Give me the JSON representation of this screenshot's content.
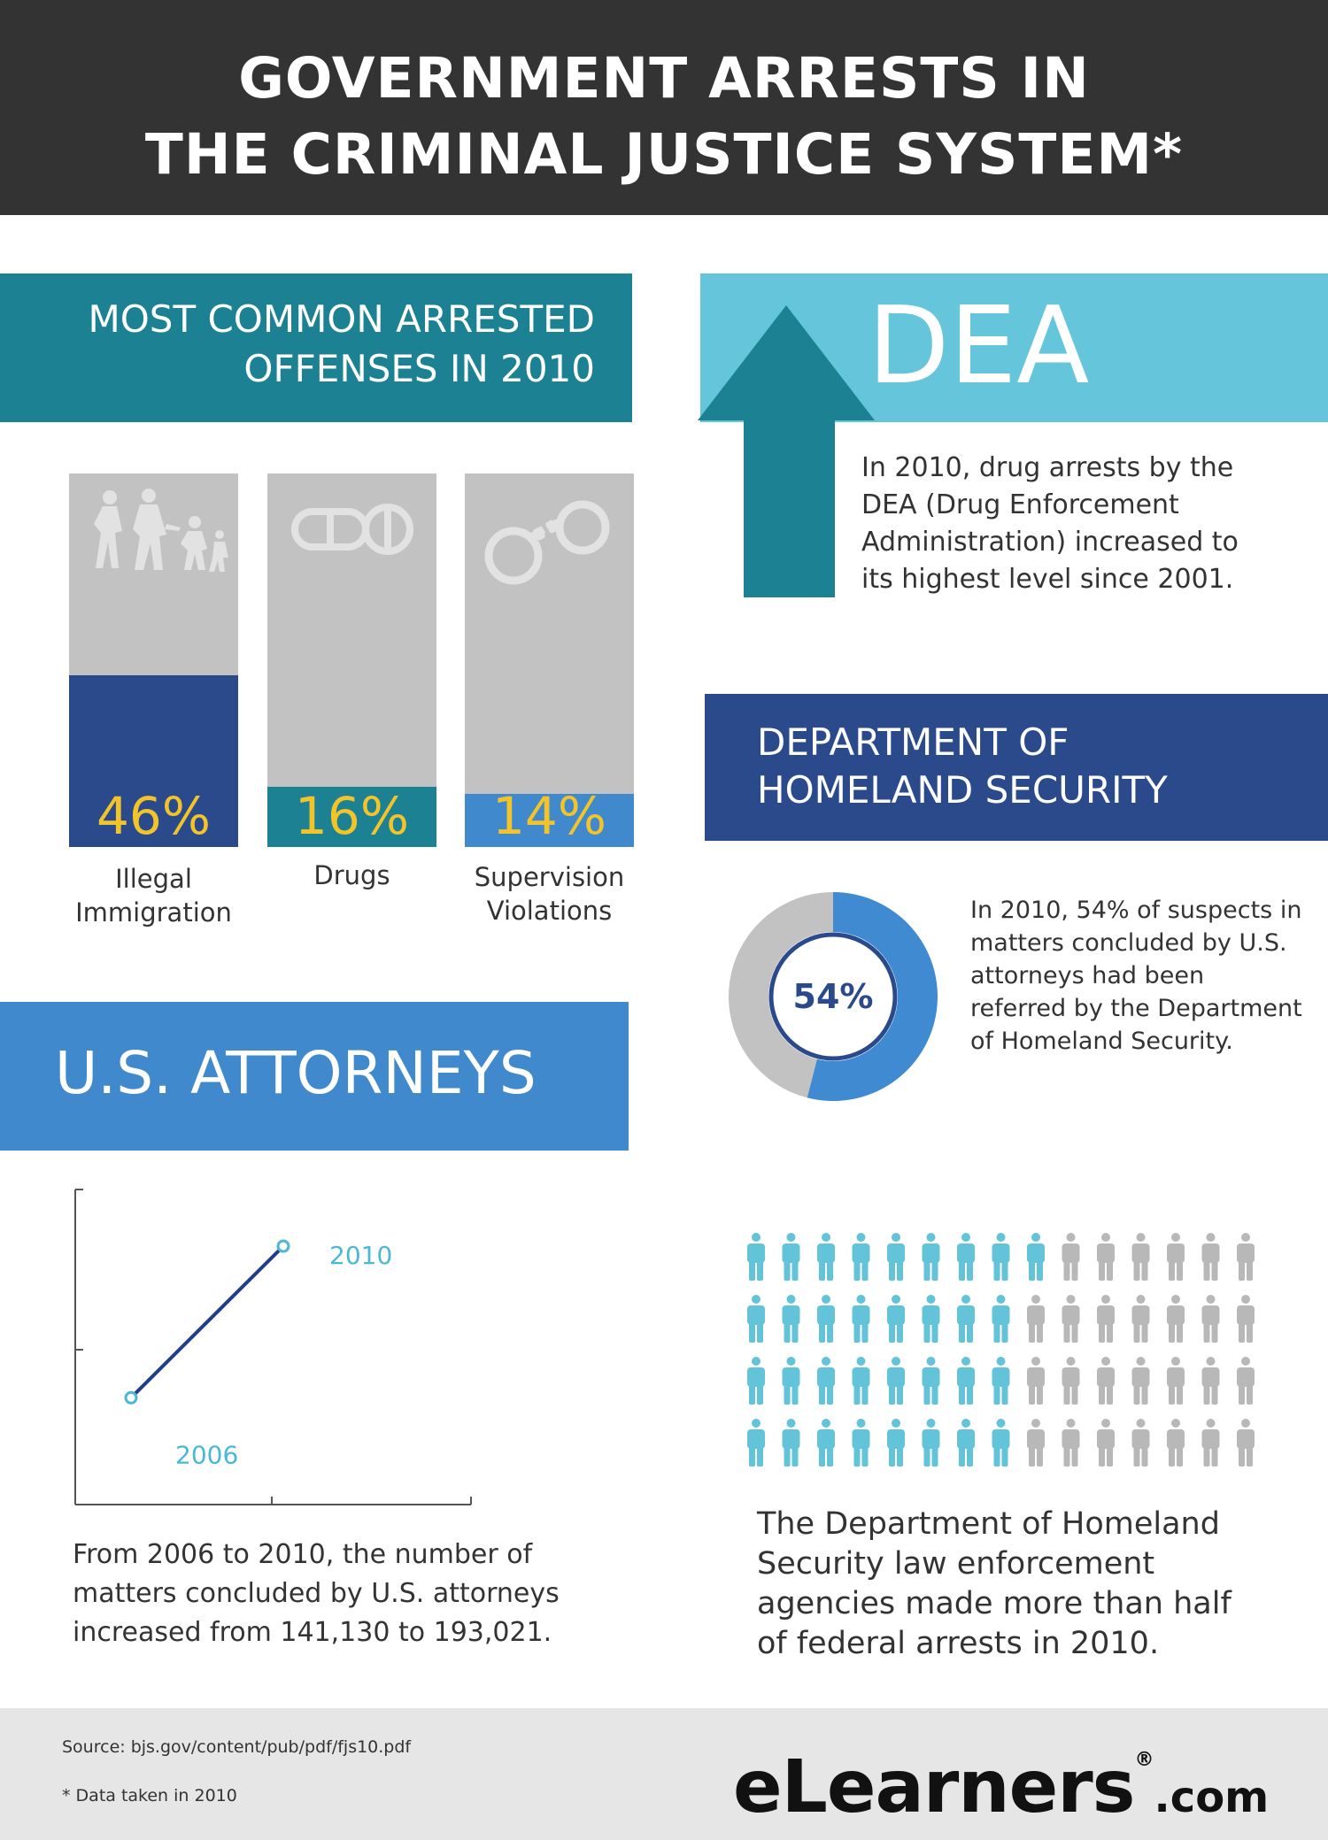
{
  "header": {
    "title": "GOVERNMENT ARRESTS IN\nTHE CRIMINAL JUSTICE SYSTEM*"
  },
  "offenses": {
    "title": "MOST COMMON ARRESTED\nOFFENSES IN 2010",
    "items": [
      {
        "label": "Illegal\nImmigration",
        "pct_text": "46%",
        "color": "#2a4a8c",
        "icon": "fleeing-family-icon"
      },
      {
        "label": "Drugs",
        "pct_text": "16%",
        "color": "#1d8194",
        "icon": "pills-icon"
      },
      {
        "label": "Supervision\nViolations",
        "pct_text": "14%",
        "color": "#4089cc",
        "icon": "handcuffs-icon"
      }
    ]
  },
  "dea": {
    "title": "DEA",
    "text": "In 2010, drug arrests by the DEA (Drug Enforcement Administration) increased to its highest level since 2001."
  },
  "dhs": {
    "title": "DEPARTMENT OF\nHOMELAND SECURITY",
    "donut_text": "In 2010, 54% of suspects in matters concluded by U.S. attorneys had been referred by the Department of Homeland Security.",
    "people_text": "The Department of Homeland Security law enforcement agencies made more than half of federal arrests in 2010.",
    "people_icon": "person-icon",
    "people_rows": [
      9,
      8,
      8,
      8
    ],
    "people_per_row": 15
  },
  "us_attorneys": {
    "title": "U.S. ATTORNEYS",
    "text": "From 2006 to 2010, the number of matters concluded by U.S. attorneys increased from 141,130 to 193,021."
  },
  "footer": {
    "source": "Source:  bjs.gov/content/pub/pdf/fjs10.pdf",
    "note": "* Data taken in 2010",
    "logo_main": "eLearners",
    "logo_reg": "®",
    "logo_suffix": ".com"
  },
  "chart_data": [
    {
      "type": "bar",
      "categories": [
        "Illegal Immigration",
        "Drugs",
        "Supervision Violations"
      ],
      "values": [
        46,
        16,
        14
      ],
      "title": "MOST COMMON ARRESTED OFFENSES IN 2010",
      "ylim": [
        0,
        100
      ]
    },
    {
      "type": "pie",
      "categories": [
        "Referred by the Department of Homeland Security",
        "Other"
      ],
      "values": [
        54,
        46
      ],
      "center_label": "54%",
      "colors": [
        "#3f8ad0",
        "#c2c2c2"
      ]
    },
    {
      "type": "line",
      "x": [
        2006,
        2010
      ],
      "point_labels": [
        "2006",
        "2010"
      ],
      "series": [
        {
          "values": [
            141130,
            193021
          ]
        }
      ],
      "line_color": "#1f3d8a",
      "label_color": "#4bb8d6"
    }
  ]
}
